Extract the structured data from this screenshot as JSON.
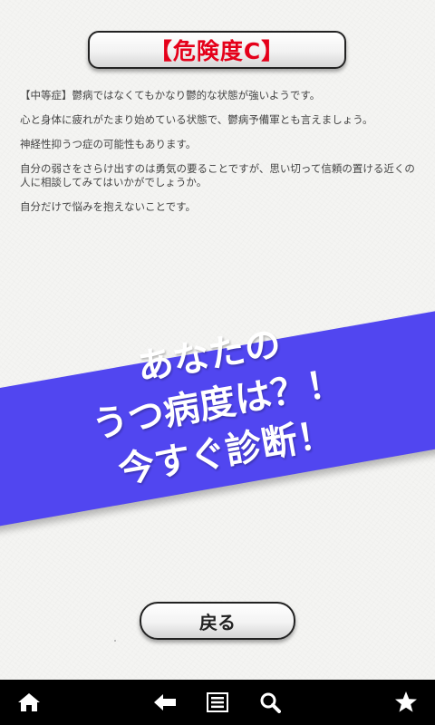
{
  "title": "【危険度C】",
  "paragraphs": [
    "【中等症】鬱病ではなくてもかなり鬱的な状態が強いようです。",
    "心と身体に疲れがたまり始めている状態で、鬱病予備軍とも言えましょう。",
    "神経性抑うつ症の可能性もあります。",
    "自分の弱さをさらけ出すのは勇気の要ることですが、思い切って信頼の置ける近くの人に相談してみてはいかがでしょうか。",
    "自分だけで悩みを抱えないことです。"
  ],
  "banner": {
    "line1": "あなたの",
    "line2": "うつ病度は？！",
    "line3": "今すぐ診断！",
    "color": "#5146f0"
  },
  "back_button": {
    "label": "戻る"
  },
  "bottom_nav": {
    "icons": [
      "home-icon",
      "back-arrow-icon",
      "list-icon",
      "search-icon",
      "star-icon"
    ]
  },
  "colors": {
    "title_red": "#e5001a",
    "background": "#f4f4f2",
    "nav_bar": "#000000"
  }
}
